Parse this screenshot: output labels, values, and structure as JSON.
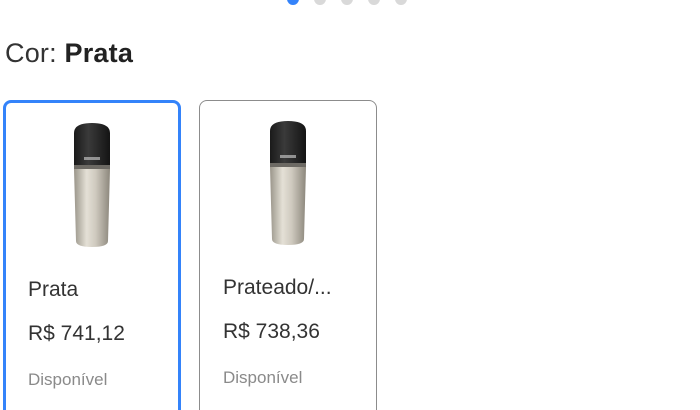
{
  "carousel": {
    "dot_count": 5,
    "active_index": 0,
    "accent_color": "#3483fa"
  },
  "color_selector": {
    "label": "Cor: ",
    "selected_value": "Prata"
  },
  "variants": [
    {
      "name": "Prata",
      "price": "R$ 741,12",
      "status": "Disponível",
      "selected": true,
      "image": "condenser-microphone"
    },
    {
      "name": "Prateado/...",
      "price": "R$ 738,36",
      "status": "Disponível",
      "selected": false,
      "image": "condenser-microphone"
    }
  ]
}
